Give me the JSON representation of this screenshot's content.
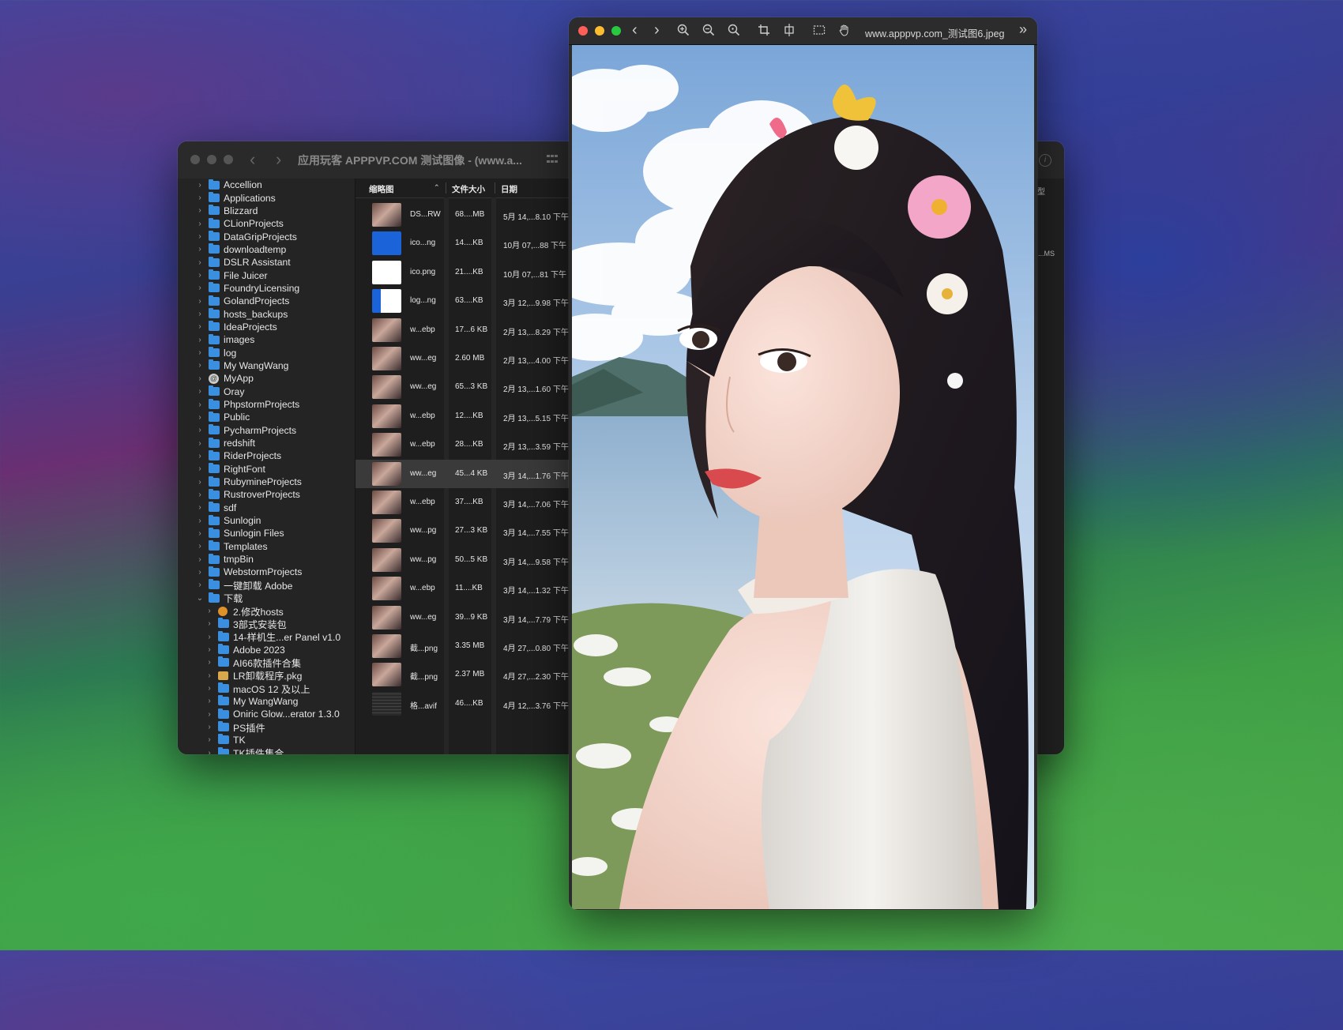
{
  "finder": {
    "title": "应用玩客 APPPVP.COM 测试图像 - (www.a...",
    "nav": {
      "back": "‹",
      "forward": "›"
    },
    "sidebar": [
      {
        "label": "Accellion",
        "indent": 0,
        "icon": "folder"
      },
      {
        "label": "Applications",
        "indent": 0,
        "icon": "folder"
      },
      {
        "label": "Blizzard",
        "indent": 0,
        "icon": "folder"
      },
      {
        "label": "CLionProjects",
        "indent": 0,
        "icon": "folder"
      },
      {
        "label": "DataGripProjects",
        "indent": 0,
        "icon": "folder"
      },
      {
        "label": "downloadtemp",
        "indent": 0,
        "icon": "folder"
      },
      {
        "label": "DSLR Assistant",
        "indent": 0,
        "icon": "folder"
      },
      {
        "label": "File Juicer",
        "indent": 0,
        "icon": "folder"
      },
      {
        "label": "FoundryLicensing",
        "indent": 0,
        "icon": "folder"
      },
      {
        "label": "GolandProjects",
        "indent": 0,
        "icon": "folder"
      },
      {
        "label": "hosts_backups",
        "indent": 0,
        "icon": "folder"
      },
      {
        "label": "IdeaProjects",
        "indent": 0,
        "icon": "folder"
      },
      {
        "label": "images",
        "indent": 0,
        "icon": "folder"
      },
      {
        "label": "log",
        "indent": 0,
        "icon": "folder"
      },
      {
        "label": "My WangWang",
        "indent": 0,
        "icon": "folder"
      },
      {
        "label": "MyApp",
        "indent": 0,
        "icon": "app"
      },
      {
        "label": "Oray",
        "indent": 0,
        "icon": "folder"
      },
      {
        "label": "PhpstormProjects",
        "indent": 0,
        "icon": "folder"
      },
      {
        "label": "Public",
        "indent": 0,
        "icon": "folder"
      },
      {
        "label": "PycharmProjects",
        "indent": 0,
        "icon": "folder"
      },
      {
        "label": "redshift",
        "indent": 0,
        "icon": "folder"
      },
      {
        "label": "RiderProjects",
        "indent": 0,
        "icon": "folder"
      },
      {
        "label": "RightFont",
        "indent": 0,
        "icon": "folder"
      },
      {
        "label": "RubymineProjects",
        "indent": 0,
        "icon": "folder"
      },
      {
        "label": "RustroverProjects",
        "indent": 0,
        "icon": "folder"
      },
      {
        "label": "sdf",
        "indent": 0,
        "icon": "folder"
      },
      {
        "label": "Sunlogin",
        "indent": 0,
        "icon": "folder"
      },
      {
        "label": "Sunlogin Files",
        "indent": 0,
        "icon": "folder"
      },
      {
        "label": "Templates",
        "indent": 0,
        "icon": "folder"
      },
      {
        "label": "tmpBin",
        "indent": 0,
        "icon": "folder"
      },
      {
        "label": "WebstormProjects",
        "indent": 0,
        "icon": "folder"
      },
      {
        "label": "一键卸载 Adobe",
        "indent": 0,
        "icon": "folder"
      },
      {
        "label": "下载",
        "indent": 0,
        "icon": "folder",
        "expanded": true
      },
      {
        "label": "2.修改hosts",
        "indent": 1,
        "icon": "orange"
      },
      {
        "label": "3部式安装包",
        "indent": 1,
        "icon": "folder"
      },
      {
        "label": "14-样机生...er Panel v1.0",
        "indent": 1,
        "icon": "folder"
      },
      {
        "label": "Adobe 2023",
        "indent": 1,
        "icon": "folder"
      },
      {
        "label": "AI66款插件合集",
        "indent": 1,
        "icon": "folder"
      },
      {
        "label": "LR卸载程序.pkg",
        "indent": 1,
        "icon": "pkg"
      },
      {
        "label": "macOS 12 及以上",
        "indent": 1,
        "icon": "folder"
      },
      {
        "label": "My WangWang",
        "indent": 1,
        "icon": "folder"
      },
      {
        "label": "Oniric Glow...erator 1.3.0",
        "indent": 1,
        "icon": "folder"
      },
      {
        "label": "PS插件",
        "indent": 1,
        "icon": "folder"
      },
      {
        "label": "TK",
        "indent": 1,
        "icon": "folder"
      },
      {
        "label": "TK插件集合",
        "indent": 1,
        "icon": "folder"
      }
    ],
    "list_headers": {
      "thumb": "缩略图",
      "size": "文件大小",
      "date": "日期"
    },
    "rows": [
      {
        "name": "DS...RW",
        "size": "68....MB",
        "date": "5月 14,...8.10 下午",
        "thumb": "photo"
      },
      {
        "name": "ico...ng",
        "size": "14....KB",
        "date": "10月 07,...88 下午",
        "thumb": "logo"
      },
      {
        "name": "ico.png",
        "size": "21....KB",
        "date": "10月 07,...81 下午",
        "thumb": "logo2"
      },
      {
        "name": "log...ng",
        "size": "63....KB",
        "date": "3月 12,...9.98 下午",
        "thumb": "banner"
      },
      {
        "name": "w...ebp",
        "size": "17...6 KB",
        "date": "2月 13,...8.29 下午",
        "thumb": "photo"
      },
      {
        "name": "ww...eg",
        "size": "2.60 MB",
        "date": "2月 13,...4.00 下午",
        "thumb": "photo"
      },
      {
        "name": "ww...eg",
        "size": "65...3 KB",
        "date": "2月 13,...1.60 下午",
        "thumb": "photo"
      },
      {
        "name": "w...ebp",
        "size": "12....KB",
        "date": "2月 13,...5.15 下午",
        "thumb": "photo"
      },
      {
        "name": "w...ebp",
        "size": "28....KB",
        "date": "2月 13,...3.59 下午",
        "thumb": "photo"
      },
      {
        "name": "ww...eg",
        "size": "45...4 KB",
        "date": "3月 14,...1.76 下午",
        "thumb": "photo",
        "selected": true
      },
      {
        "name": "w...ebp",
        "size": "37....KB",
        "date": "3月 14,...7.06 下午",
        "thumb": "photo"
      },
      {
        "name": "ww...pg",
        "size": "27...3 KB",
        "date": "3月 14,...7.55 下午",
        "thumb": "photo"
      },
      {
        "name": "ww...pg",
        "size": "50...5 KB",
        "date": "3月 14,...9.58 下午",
        "thumb": "photo"
      },
      {
        "name": "w...ebp",
        "size": "11....KB",
        "date": "3月 14,...1.32 下午",
        "thumb": "photo"
      },
      {
        "name": "ww...eg",
        "size": "39...9 KB",
        "date": "3月 14,...7.79 下午",
        "thumb": "photo"
      },
      {
        "name": "截...png",
        "size": "3.35 MB",
        "date": "4月 27,...0.80 下午",
        "thumb": "photo"
      },
      {
        "name": "截...png",
        "size": "2.37 MB",
        "date": "4月 27,...2.30 下午",
        "thumb": "photo"
      },
      {
        "name": "格...avif",
        "size": "46....KB",
        "date": "4月 12,...3.76 下午",
        "thumb": "dark"
      }
    ],
    "right_pane": {
      "header": "型",
      "cell": "...MS"
    }
  },
  "viewer": {
    "title": "www.apppvp.com_测试图6.jpeg",
    "toolbar": {
      "back": "‹",
      "forward": "›",
      "more": "»"
    }
  }
}
